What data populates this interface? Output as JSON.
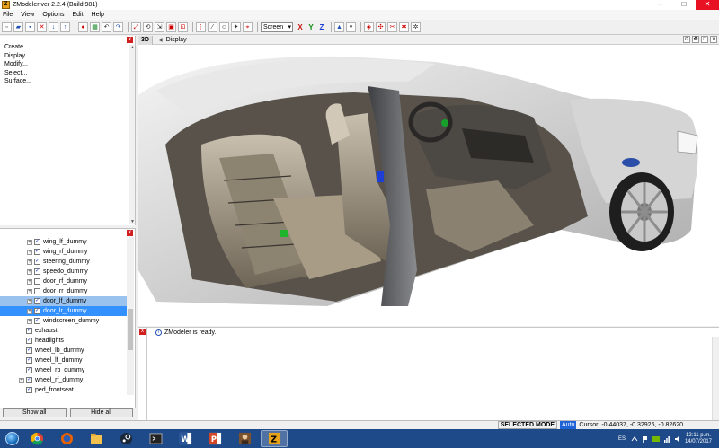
{
  "window": {
    "title": "ZModeler ver 2.2.4 (Build 981)",
    "app_icon_letter": "Z",
    "minimize": "–",
    "maximize": "□",
    "close": "✕"
  },
  "menu": [
    "File",
    "View",
    "Options",
    "Edit",
    "Help"
  ],
  "toolbar": {
    "coord_mode": "Screen",
    "axis_x": "X",
    "axis_y": "Y",
    "axis_z": "Z"
  },
  "command_panel": {
    "items": [
      "Create...",
      "Display...",
      "Modify...",
      "Select...",
      "Surface..."
    ]
  },
  "tree": {
    "rows": [
      {
        "label": "wing_lf_dummy",
        "indent": 2,
        "expander": true,
        "checked": true,
        "state": ""
      },
      {
        "label": "wing_rf_dummy",
        "indent": 2,
        "expander": true,
        "checked": true,
        "state": ""
      },
      {
        "label": "steering_dummy",
        "indent": 2,
        "expander": true,
        "checked": true,
        "state": ""
      },
      {
        "label": "speedo_dummy",
        "indent": 2,
        "expander": true,
        "checked": true,
        "state": ""
      },
      {
        "label": "door_rf_dummy",
        "indent": 2,
        "expander": true,
        "checked": false,
        "state": ""
      },
      {
        "label": "door_rr_dummy",
        "indent": 2,
        "expander": true,
        "checked": false,
        "state": ""
      },
      {
        "label": "door_lf_dummy",
        "indent": 2,
        "expander": true,
        "checked": true,
        "state": "sel2"
      },
      {
        "label": "door_lr_dummy",
        "indent": 2,
        "expander": true,
        "checked": true,
        "state": "sel"
      },
      {
        "label": "windscreen_dummy",
        "indent": 2,
        "expander": true,
        "checked": true,
        "state": ""
      },
      {
        "label": "exhaust",
        "indent": 1,
        "expander": false,
        "checked": true,
        "state": ""
      },
      {
        "label": "headlights",
        "indent": 1,
        "expander": false,
        "checked": true,
        "state": ""
      },
      {
        "label": "wheel_lb_dummy",
        "indent": 1,
        "expander": false,
        "checked": true,
        "state": ""
      },
      {
        "label": "wheel_lf_dummy",
        "indent": 1,
        "expander": false,
        "checked": true,
        "state": ""
      },
      {
        "label": "wheel_rb_dummy",
        "indent": 1,
        "expander": false,
        "checked": true,
        "state": ""
      },
      {
        "label": "wheel_rf_dummy",
        "indent": 1,
        "expander": true,
        "checked": true,
        "state": ""
      },
      {
        "label": "ped_frontseat",
        "indent": 1,
        "expander": false,
        "checked": true,
        "state": ""
      }
    ],
    "show_all": "Show all",
    "hide_all": "Hide all"
  },
  "viewport": {
    "label": "3D",
    "title": "Display"
  },
  "log": {
    "message": "ZModeler is ready."
  },
  "status": {
    "mode": "SELECTED MODE",
    "auto": "Auto",
    "cursor": "Cursor: -0.44037, -0.32926, -0.82620"
  },
  "taskbar": {
    "apps": [
      "chrome-icon",
      "firefox-icon",
      "explorer-icon",
      "steam-icon",
      "terminal-icon",
      "word-icon",
      "powerpoint-icon",
      "photo-icon",
      "zmodeler-icon"
    ],
    "lang": "ES",
    "time": "12:11 p.m.",
    "date": "14/07/2017"
  },
  "colors": {
    "selection": "#3390ff",
    "taskbar": "#1e4a8a",
    "close_red": "#e81123"
  }
}
